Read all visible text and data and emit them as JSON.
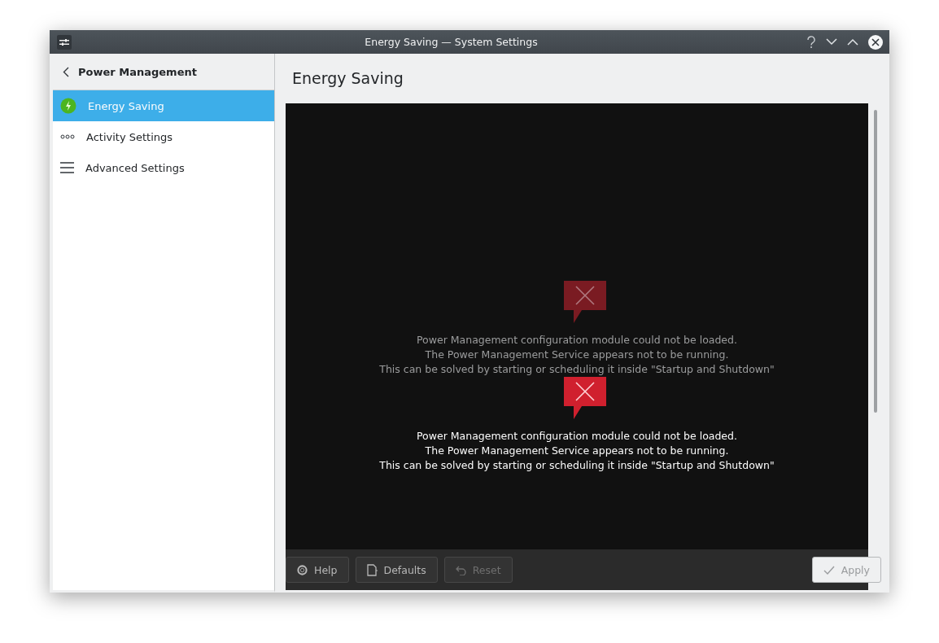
{
  "window": {
    "title": "Energy Saving — System Settings"
  },
  "sidebar": {
    "header": "Power Management",
    "items": [
      {
        "label": "Energy Saving",
        "selected": true
      },
      {
        "label": "Activity Settings",
        "selected": false
      },
      {
        "label": "Advanced Settings",
        "selected": false
      }
    ]
  },
  "page_title": "Energy Saving",
  "errors": [
    {
      "faded": true,
      "lines": [
        "Power Management configuration module could not be loaded.",
        "The Power Management Service appears not to be running.",
        "This can be solved by starting or scheduling it inside \"Startup and Shutdown\""
      ]
    },
    {
      "faded": false,
      "lines": [
        "Power Management configuration module could not be loaded.",
        "The Power Management Service appears not to be running.",
        "This can be solved by starting or scheduling it inside \"Startup and Shutdown\""
      ]
    }
  ],
  "buttons": [
    {
      "label": "Help",
      "disabled": false
    },
    {
      "label": "Defaults",
      "disabled": false
    },
    {
      "label": "Reset",
      "disabled": true
    },
    {
      "label": "Apply",
      "disabled": true
    }
  ]
}
